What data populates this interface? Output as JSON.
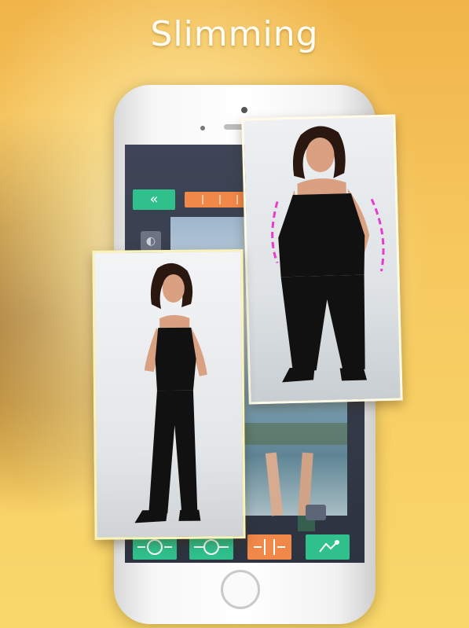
{
  "promo": {
    "headline": "Slimming"
  },
  "app": {
    "top_bar": {
      "back_icon": "double-chevron-left-icon"
    },
    "toolbar": {
      "tools": [
        {
          "icon": "shrink-body-icon",
          "color": "#2fc08c"
        },
        {
          "icon": "expand-body-icon",
          "color": "#2fc08c"
        },
        {
          "icon": "slim-waist-icon",
          "color": "#f0884a"
        },
        {
          "icon": "hand-touch-icon",
          "color": "#2fc08c"
        }
      ]
    }
  },
  "colors": {
    "accent_green": "#2fc08c",
    "accent_orange": "#f0884a",
    "contour_guide": "#e83ad0",
    "background_gold": "#f6c85e"
  },
  "photos": {
    "before": {
      "icon": "before-photo",
      "contour": "dashed-slim-guide"
    },
    "after": {
      "icon": "after-photo"
    }
  }
}
